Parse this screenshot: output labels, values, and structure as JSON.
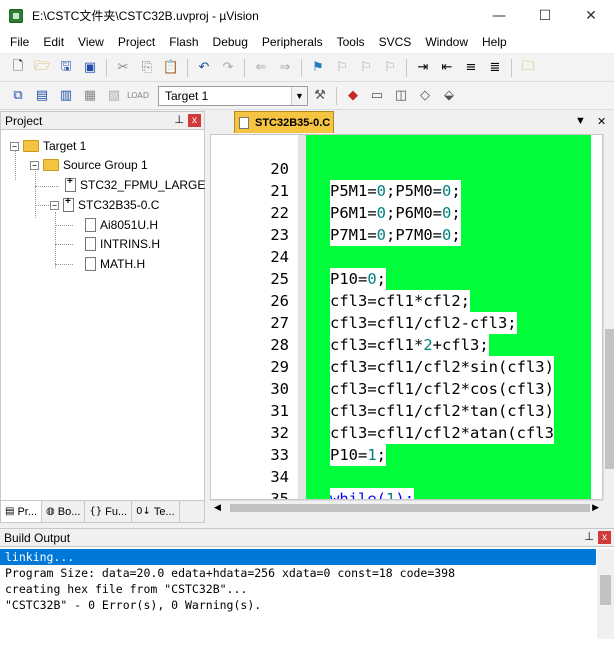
{
  "window": {
    "title": "E:\\CSTC文件夹\\CSTC32B.uvproj - µVision",
    "minimize": "—",
    "maximize": "☐",
    "close": "✕"
  },
  "menu": [
    "File",
    "Edit",
    "View",
    "Project",
    "Flash",
    "Debug",
    "Peripherals",
    "Tools",
    "SVCS",
    "Window",
    "Help"
  ],
  "toolbar": {
    "target_value": "Target 1"
  },
  "project_panel": {
    "title": "Project",
    "pin": "⊥",
    "close": "x",
    "tree": {
      "target": "Target 1",
      "group": "Source Group 1",
      "files": [
        "STC32_FPMU_LARGE",
        "STC32B35-0.C"
      ],
      "includes": [
        "Ai8051U.H",
        "INTRINS.H",
        "MATH.H"
      ]
    },
    "tabs": [
      "Pr...",
      "Bo...",
      "Fu...",
      "Te..."
    ]
  },
  "editor": {
    "tab_label": "STC32B35-0.C",
    "lines": [
      {
        "n": "20",
        "code": "P5M1=0;P5M0=0;"
      },
      {
        "n": "21",
        "code": "P6M1=0;P6M0=0;"
      },
      {
        "n": "22",
        "code": "P7M1=0;P7M0=0;"
      },
      {
        "n": "23",
        "code": ""
      },
      {
        "n": "24",
        "code": "P10=0;"
      },
      {
        "n": "25",
        "code": "cfl3=cfl1*cfl2;"
      },
      {
        "n": "26",
        "code": "cfl3=cfl1/cfl2-cfl3;"
      },
      {
        "n": "27",
        "code": "cfl3=cfl1*2+cfl3;"
      },
      {
        "n": "28",
        "code": "cfl3=cfl1/cfl2*sin(cfl3)"
      },
      {
        "n": "29",
        "code": "cfl3=cfl1/cfl2*cos(cfl3)"
      },
      {
        "n": "30",
        "code": "cfl3=cfl1/cfl2*tan(cfl3)"
      },
      {
        "n": "31",
        "code": "cfl3=cfl1/cfl2*atan(cfl3"
      },
      {
        "n": "32",
        "code": "P10=1;"
      },
      {
        "n": "33",
        "code": ""
      },
      {
        "n": "34",
        "code": "while(1);"
      },
      {
        "n": "35",
        "code": "}"
      }
    ]
  },
  "build_output": {
    "title": "Build Output",
    "lines": [
      "linking...",
      "Program Size: data=20.0 edata+hdata=256 xdata=0 const=18 code=398",
      "creating hex file from \"CSTC32B\"...",
      "\"CSTC32B\" - 0 Error(s), 0 Warning(s)."
    ]
  }
}
